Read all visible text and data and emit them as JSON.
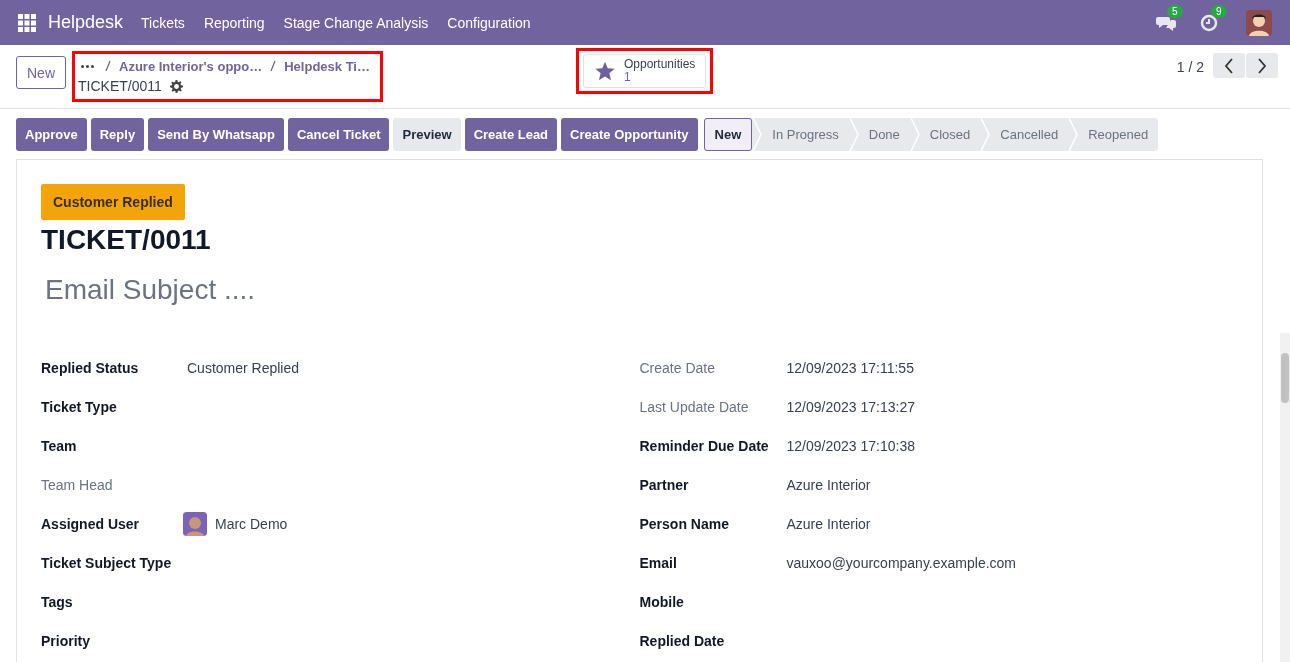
{
  "navbar": {
    "app": "Helpdesk",
    "menu": [
      "Tickets",
      "Reporting",
      "Stage Change Analysis",
      "Configuration"
    ],
    "messages_badge": "5",
    "activities_badge": "9"
  },
  "control_panel": {
    "new_button": "New",
    "breadcrumbs": [
      "Azure Interior's oppo…",
      "Helpdesk Ti…"
    ],
    "record": "TICKET/0011",
    "smart_button": {
      "label": "Opportunities",
      "count": "1"
    },
    "pager": "1 / 2"
  },
  "actions": [
    {
      "label": "Approve",
      "primary": true
    },
    {
      "label": "Reply",
      "primary": true
    },
    {
      "label": "Send By Whatsapp",
      "primary": true
    },
    {
      "label": "Cancel Ticket",
      "primary": true
    },
    {
      "label": "Preview",
      "primary": false
    },
    {
      "label": "Create Lead",
      "primary": true
    },
    {
      "label": "Create Opportunity",
      "primary": true
    }
  ],
  "stages": [
    {
      "label": "New",
      "selected": true
    },
    {
      "label": "In Progress",
      "selected": false
    },
    {
      "label": "Done",
      "selected": false
    },
    {
      "label": "Closed",
      "selected": false
    },
    {
      "label": "Cancelled",
      "selected": false
    },
    {
      "label": "Reopened",
      "selected": false
    }
  ],
  "form": {
    "badge": "Customer Replied",
    "title": "TICKET/0011",
    "subject_placeholder": "Email Subject ....",
    "left_fields": [
      {
        "label": "Replied Status",
        "value": "Customer Replied",
        "readonly": false,
        "kind": "text"
      },
      {
        "label": "Ticket Type",
        "readonly": false
      },
      {
        "label": "Team",
        "readonly": false
      },
      {
        "label": "Team Head",
        "readonly": true
      },
      {
        "label": "Assigned User",
        "value": "Marc Demo",
        "readonly": false,
        "kind": "user"
      },
      {
        "label": "Ticket Subject Type",
        "readonly": false
      },
      {
        "label": "Tags",
        "readonly": false
      },
      {
        "label": "Priority",
        "readonly": false
      }
    ],
    "right_fields": [
      {
        "label": "Create Date",
        "value": "12/09/2023 17:11:55",
        "readonly": true,
        "kind": "text"
      },
      {
        "label": "Last Update Date",
        "value": "12/09/2023 17:13:27",
        "readonly": true,
        "kind": "text"
      },
      {
        "label": "Reminder Due Date",
        "value": "12/09/2023 17:10:38",
        "readonly": false,
        "kind": "text"
      },
      {
        "label": "Partner",
        "value": "Azure Interior",
        "readonly": false,
        "kind": "text"
      },
      {
        "label": "Person Name",
        "value": "Azure Interior",
        "readonly": false,
        "kind": "text"
      },
      {
        "label": "Email",
        "value": "vauxoo@yourcompany.example.com",
        "readonly": false,
        "kind": "text"
      },
      {
        "label": "Mobile",
        "readonly": false
      },
      {
        "label": "Replied Date",
        "readonly": false
      }
    ]
  }
}
